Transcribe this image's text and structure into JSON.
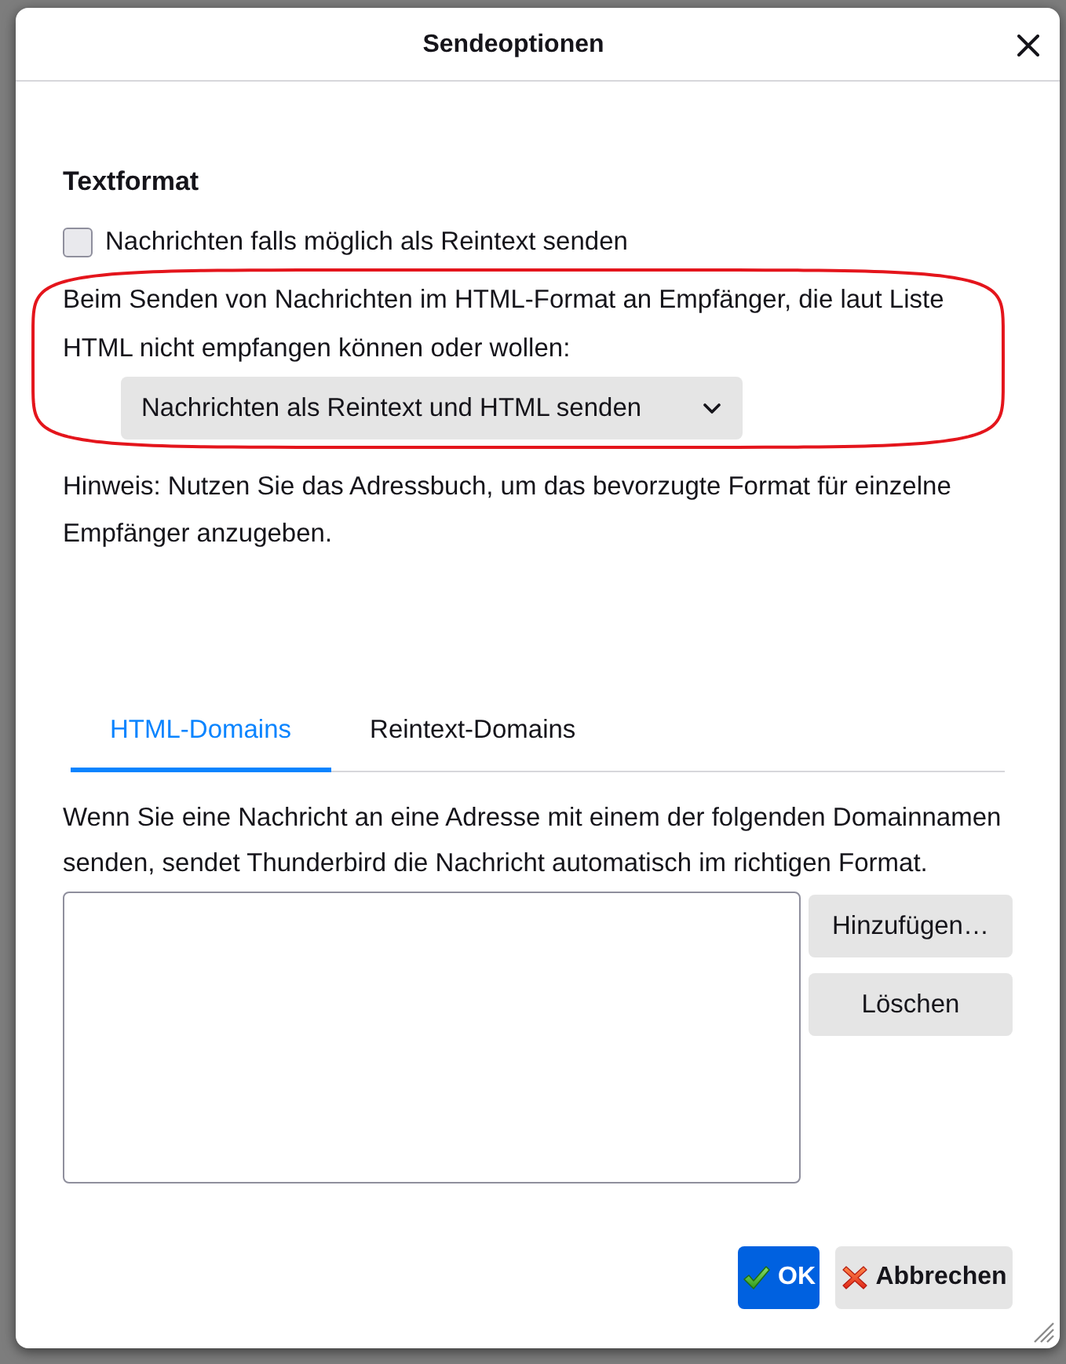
{
  "dialog": {
    "title": "Sendeoptionen"
  },
  "text_format": {
    "heading": "Textformat",
    "plaintext_checkbox": {
      "label": "Nachrichten falls möglich als Reintext senden",
      "checked": false
    },
    "description": "Beim Senden von Nachrichten im HTML-Format an Empfänger, die laut Liste HTML nicht empfangen können oder wollen:",
    "format_select": {
      "value": "Nachrichten als Reintext und HTML senden"
    },
    "annotation": {
      "kind": "ellipse"
    },
    "hint": "Hinweis: Nutzen Sie das Adressbuch, um das bevorzugte Format für einzelne Empfänger anzugeben."
  },
  "domain_tabs": [
    {
      "label": "HTML-Domains",
      "selected": true
    },
    {
      "label": "Reintext-Domains",
      "selected": false
    }
  ],
  "domains": {
    "description": "Wenn Sie eine Nachricht an eine Adresse mit einem der folgenden Domainnamen senden, sendet Thunderbird die Nachricht automatisch im richtigen Format.",
    "buttons": [
      {
        "label": "Hinzufügen…"
      },
      {
        "label": "Löschen"
      }
    ]
  },
  "footer_buttons": [
    {
      "kind": "ok",
      "label": "OK"
    },
    {
      "kind": "cancel",
      "label": "Abbrechen"
    }
  ]
}
